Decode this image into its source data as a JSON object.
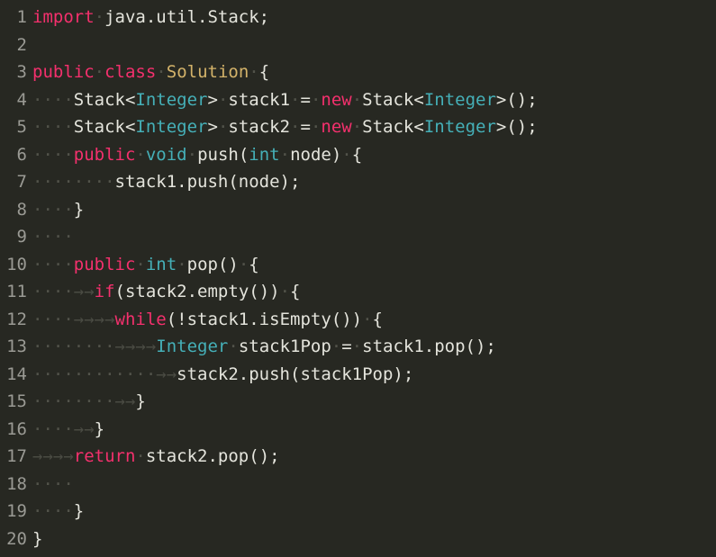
{
  "editor": {
    "language": "java",
    "theme": "monokai-dark",
    "background_color": "#272822",
    "line_number_color": "#9a9a94",
    "whitespace_marker": "·",
    "tab_marker": "→",
    "total_lines": 20,
    "colors": {
      "keyword": "#f4306d",
      "type": "#45b0b8",
      "class_name": "#d4b36a",
      "plain_text": "#e4e4dc",
      "whitespace": "#52534a"
    }
  },
  "lines": [
    {
      "number": "1",
      "tokens": [
        {
          "text": "import",
          "kind": "kw"
        },
        {
          "text": "·",
          "kind": "ws"
        },
        {
          "text": "java.util.Stack;",
          "kind": "plain"
        }
      ]
    },
    {
      "number": "2",
      "tokens": []
    },
    {
      "number": "3",
      "tokens": [
        {
          "text": "public",
          "kind": "kw"
        },
        {
          "text": "·",
          "kind": "ws"
        },
        {
          "text": "class",
          "kind": "kw"
        },
        {
          "text": "·",
          "kind": "ws"
        },
        {
          "text": "Solution",
          "kind": "cls"
        },
        {
          "text": "·",
          "kind": "ws"
        },
        {
          "text": "{",
          "kind": "plain"
        }
      ]
    },
    {
      "number": "4",
      "tokens": [
        {
          "text": "····",
          "kind": "ws"
        },
        {
          "text": "Stack<",
          "kind": "plain"
        },
        {
          "text": "Integer",
          "kind": "type"
        },
        {
          "text": ">",
          "kind": "plain"
        },
        {
          "text": "·",
          "kind": "ws"
        },
        {
          "text": "stack1",
          "kind": "plain"
        },
        {
          "text": "·",
          "kind": "ws"
        },
        {
          "text": "=",
          "kind": "plain"
        },
        {
          "text": "·",
          "kind": "ws"
        },
        {
          "text": "new",
          "kind": "kw"
        },
        {
          "text": "·",
          "kind": "ws"
        },
        {
          "text": "Stack<",
          "kind": "plain"
        },
        {
          "text": "Integer",
          "kind": "type"
        },
        {
          "text": ">();",
          "kind": "plain"
        }
      ]
    },
    {
      "number": "5",
      "tokens": [
        {
          "text": "····",
          "kind": "ws"
        },
        {
          "text": "Stack<",
          "kind": "plain"
        },
        {
          "text": "Integer",
          "kind": "type"
        },
        {
          "text": ">",
          "kind": "plain"
        },
        {
          "text": "·",
          "kind": "ws"
        },
        {
          "text": "stack2",
          "kind": "plain"
        },
        {
          "text": "·",
          "kind": "ws"
        },
        {
          "text": "=",
          "kind": "plain"
        },
        {
          "text": "·",
          "kind": "ws"
        },
        {
          "text": "new",
          "kind": "kw"
        },
        {
          "text": "·",
          "kind": "ws"
        },
        {
          "text": "Stack<",
          "kind": "plain"
        },
        {
          "text": "Integer",
          "kind": "type"
        },
        {
          "text": ">();",
          "kind": "plain"
        }
      ]
    },
    {
      "number": "6",
      "tokens": [
        {
          "text": "····",
          "kind": "ws"
        },
        {
          "text": "public",
          "kind": "kw"
        },
        {
          "text": "·",
          "kind": "ws"
        },
        {
          "text": "void",
          "kind": "type"
        },
        {
          "text": "·",
          "kind": "ws"
        },
        {
          "text": "push(",
          "kind": "plain"
        },
        {
          "text": "int",
          "kind": "type"
        },
        {
          "text": "·",
          "kind": "ws"
        },
        {
          "text": "node)",
          "kind": "plain"
        },
        {
          "text": "·",
          "kind": "ws"
        },
        {
          "text": "{",
          "kind": "plain"
        }
      ]
    },
    {
      "number": "7",
      "tokens": [
        {
          "text": "········",
          "kind": "ws"
        },
        {
          "text": "stack1.push(node);",
          "kind": "plain"
        }
      ]
    },
    {
      "number": "8",
      "tokens": [
        {
          "text": "····",
          "kind": "ws"
        },
        {
          "text": "}",
          "kind": "plain"
        }
      ]
    },
    {
      "number": "9",
      "tokens": [
        {
          "text": "····",
          "kind": "ws"
        }
      ]
    },
    {
      "number": "10",
      "tokens": [
        {
          "text": "····",
          "kind": "ws"
        },
        {
          "text": "public",
          "kind": "kw"
        },
        {
          "text": "·",
          "kind": "ws"
        },
        {
          "text": "int",
          "kind": "type"
        },
        {
          "text": "·",
          "kind": "ws"
        },
        {
          "text": "pop()",
          "kind": "plain"
        },
        {
          "text": "·",
          "kind": "ws"
        },
        {
          "text": "{",
          "kind": "plain"
        }
      ]
    },
    {
      "number": "11",
      "tokens": [
        {
          "text": "····",
          "kind": "ws"
        },
        {
          "text": "→→",
          "kind": "tab"
        },
        {
          "text": "if",
          "kind": "kw"
        },
        {
          "text": "(stack2.empty())",
          "kind": "plain"
        },
        {
          "text": "·",
          "kind": "ws"
        },
        {
          "text": "{",
          "kind": "plain"
        }
      ]
    },
    {
      "number": "12",
      "tokens": [
        {
          "text": "····",
          "kind": "ws"
        },
        {
          "text": "→→→→",
          "kind": "tab"
        },
        {
          "text": "while",
          "kind": "kw"
        },
        {
          "text": "(!stack1.isEmpty())",
          "kind": "plain"
        },
        {
          "text": "·",
          "kind": "ws"
        },
        {
          "text": "{",
          "kind": "plain"
        }
      ]
    },
    {
      "number": "13",
      "tokens": [
        {
          "text": "········",
          "kind": "ws"
        },
        {
          "text": "→→→→",
          "kind": "tab"
        },
        {
          "text": "Integer",
          "kind": "type"
        },
        {
          "text": "·",
          "kind": "ws"
        },
        {
          "text": "stack1Pop",
          "kind": "plain"
        },
        {
          "text": "·",
          "kind": "ws"
        },
        {
          "text": "=",
          "kind": "plain"
        },
        {
          "text": "·",
          "kind": "ws"
        },
        {
          "text": "stack1.pop();",
          "kind": "plain"
        }
      ]
    },
    {
      "number": "14",
      "tokens": [
        {
          "text": "············",
          "kind": "ws"
        },
        {
          "text": "→→",
          "kind": "tab"
        },
        {
          "text": "stack2.push(stack1Pop);",
          "kind": "plain"
        }
      ]
    },
    {
      "number": "15",
      "tokens": [
        {
          "text": "········",
          "kind": "ws"
        },
        {
          "text": "→→",
          "kind": "tab"
        },
        {
          "text": "}",
          "kind": "plain"
        }
      ]
    },
    {
      "number": "16",
      "tokens": [
        {
          "text": "····",
          "kind": "ws"
        },
        {
          "text": "→→",
          "kind": "tab"
        },
        {
          "text": "}",
          "kind": "plain"
        }
      ]
    },
    {
      "number": "17",
      "tokens": [
        {
          "text": "→→→→",
          "kind": "tab"
        },
        {
          "text": "return",
          "kind": "kw"
        },
        {
          "text": "·",
          "kind": "ws"
        },
        {
          "text": "stack2.pop();",
          "kind": "plain"
        }
      ]
    },
    {
      "number": "18",
      "tokens": [
        {
          "text": "····",
          "kind": "ws"
        }
      ]
    },
    {
      "number": "19",
      "tokens": [
        {
          "text": "····",
          "kind": "ws"
        },
        {
          "text": "}",
          "kind": "plain"
        }
      ]
    },
    {
      "number": "20",
      "tokens": [
        {
          "text": "}",
          "kind": "plain"
        }
      ]
    }
  ]
}
